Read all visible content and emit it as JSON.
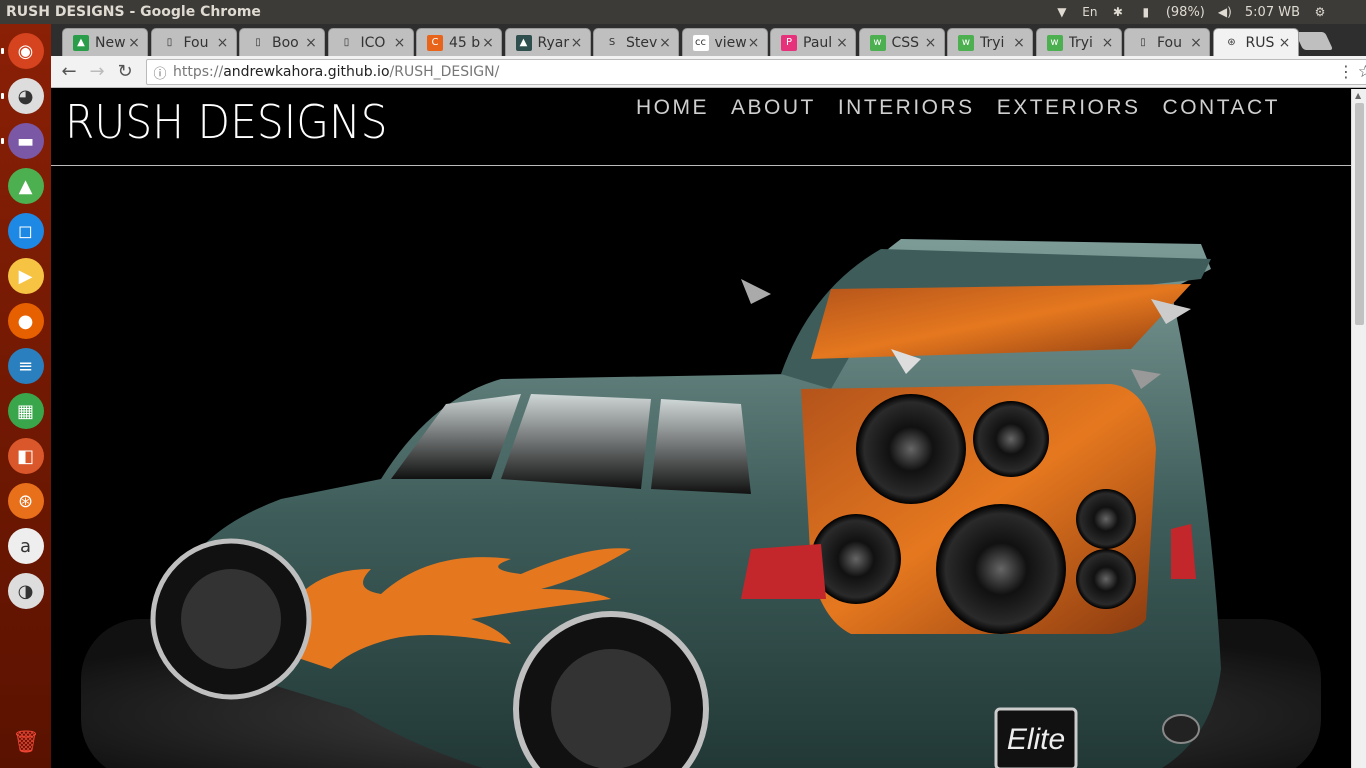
{
  "window": {
    "title": "RUSH DESIGNS - Google Chrome"
  },
  "tray": {
    "battery": "(98%)",
    "time": "5:07 WB",
    "keyboard": "En"
  },
  "launcher": {
    "items": [
      {
        "name": "ubuntu-dash-icon",
        "glyph": "◉",
        "bg": "#d5431f"
      },
      {
        "name": "chrome-icon",
        "glyph": "◕",
        "bg": "#dddddd"
      },
      {
        "name": "files-icon",
        "glyph": "▬",
        "bg": "#7b58a6"
      },
      {
        "name": "android-studio-icon",
        "glyph": "▲",
        "bg": "#4caf50"
      },
      {
        "name": "app-icon",
        "glyph": "◻",
        "bg": "#1e88e5"
      },
      {
        "name": "media-player-icon",
        "glyph": "▶",
        "bg": "#f6c343"
      },
      {
        "name": "firefox-icon",
        "glyph": "●",
        "bg": "#e66000"
      },
      {
        "name": "writer-icon",
        "glyph": "≡",
        "bg": "#2a7fbf"
      },
      {
        "name": "calc-icon",
        "glyph": "▦",
        "bg": "#3aa64c"
      },
      {
        "name": "impress-icon",
        "glyph": "◧",
        "bg": "#d9572b"
      },
      {
        "name": "software-center-icon",
        "glyph": "⊛",
        "bg": "#e8701a"
      },
      {
        "name": "amazon-icon",
        "glyph": "a",
        "bg": "#eeeeee"
      },
      {
        "name": "settings-toggle-icon",
        "glyph": "◑",
        "bg": "#dddddd"
      }
    ],
    "trash": "🗑"
  },
  "tabs": [
    {
      "label": "New",
      "fav": "▲",
      "favbg": "#2a9d4b"
    },
    {
      "label": "Fou",
      "fav": "▯",
      "favbg": "transparent"
    },
    {
      "label": "Boo",
      "fav": "▯",
      "favbg": "transparent"
    },
    {
      "label": "ICO",
      "fav": "▯",
      "favbg": "transparent"
    },
    {
      "label": "45 b",
      "fav": "C",
      "favbg": "#e8641a"
    },
    {
      "label": "Ryar",
      "fav": "▲",
      "favbg": "#2f4f4f"
    },
    {
      "label": "Stev",
      "fav": "S",
      "favbg": "transparent"
    },
    {
      "label": "view",
      "fav": "cc",
      "favbg": "#ffffff"
    },
    {
      "label": "Paul",
      "fav": "P",
      "favbg": "#e6327a"
    },
    {
      "label": "CSS",
      "fav": "w",
      "favbg": "#4caf50"
    },
    {
      "label": "Tryi",
      "fav": "w",
      "favbg": "#4caf50"
    },
    {
      "label": "Tryi",
      "fav": "w",
      "favbg": "#4caf50"
    },
    {
      "label": "Fou",
      "fav": "▯",
      "favbg": "transparent"
    },
    {
      "label": "RUS",
      "fav": "⊛",
      "favbg": "transparent",
      "active": true
    }
  ],
  "address": {
    "scheme": "https://",
    "host": "andrewkahora.github.io",
    "path": "/RUSH_DESIGN/"
  },
  "site": {
    "brand": "RUSH DESIGNS",
    "nav": [
      "HOME",
      "ABOUT",
      "INTERIORS",
      "EXTERIORS",
      "CONTACT"
    ],
    "plate": "Elite"
  },
  "colors": {
    "accent": "#e5781f",
    "body": "#44625f"
  }
}
